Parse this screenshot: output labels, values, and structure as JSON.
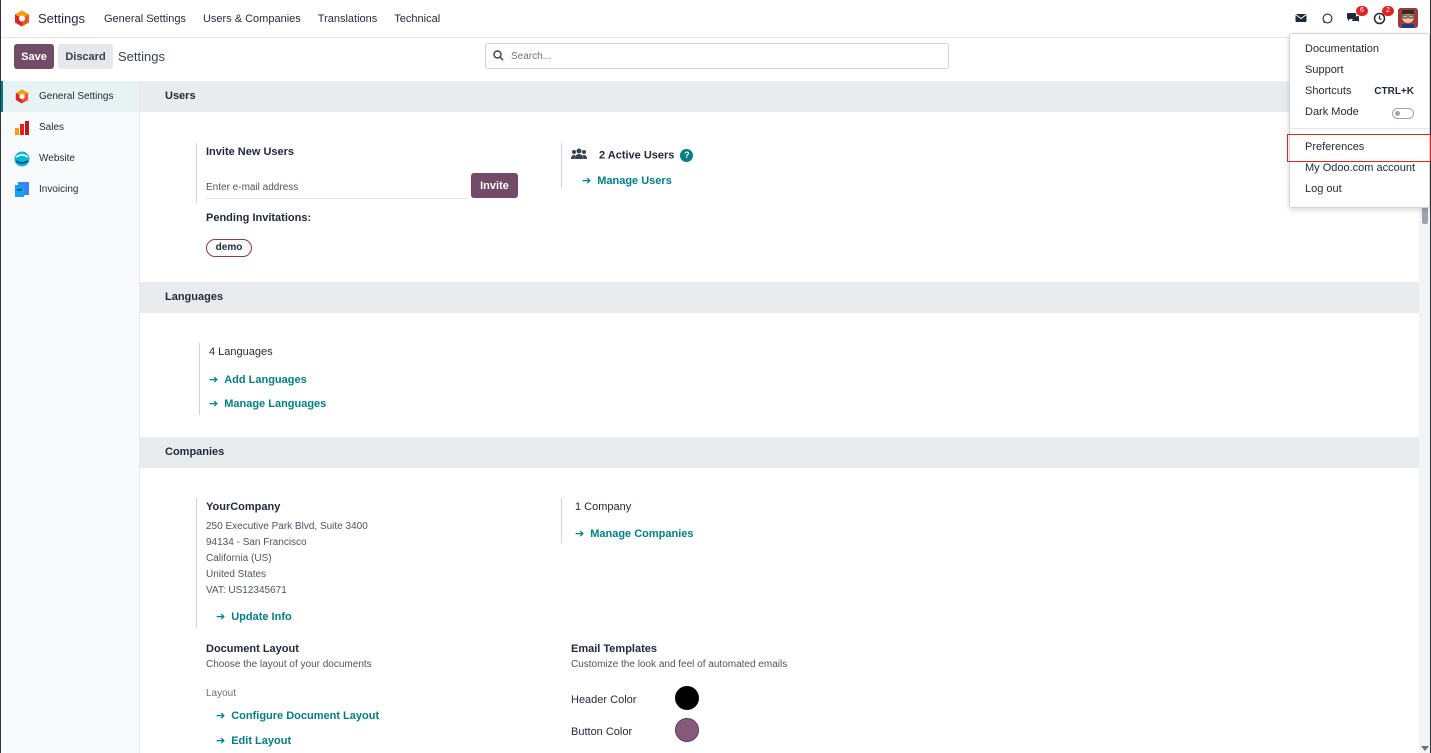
{
  "navbar": {
    "app_name": "Settings",
    "menu": [
      "General Settings",
      "Users & Companies",
      "Translations",
      "Technical"
    ],
    "chat_badge": "6",
    "activity_badge": "2"
  },
  "control_panel": {
    "save_label": "Save",
    "discard_label": "Discard",
    "title": "Settings",
    "search_placeholder": "Search..."
  },
  "sidebar": {
    "items": [
      {
        "label": "General Settings",
        "icon": "odoo-logo-icon"
      },
      {
        "label": "Sales",
        "icon": "sales-chart-icon"
      },
      {
        "label": "Website",
        "icon": "website-icon"
      },
      {
        "label": "Invoicing",
        "icon": "invoicing-icon"
      }
    ]
  },
  "users": {
    "section_title": "Users",
    "invite_title": "Invite New Users",
    "email_placeholder": "Enter e-mail address",
    "invite_label": "Invite",
    "pending_title": "Pending Invitations:",
    "pending_tag": "demo",
    "active_users": "2 Active Users",
    "manage_users": "Manage Users"
  },
  "languages": {
    "section_title": "Languages",
    "count": "4 Languages",
    "add": "Add Languages",
    "manage": "Manage Languages"
  },
  "companies": {
    "section_title": "Companies",
    "company_name": "YourCompany",
    "address_lines": [
      "250 Executive Park Blvd, Suite 3400",
      "94134 - San Francisco",
      "California (US)",
      "United States",
      "VAT:  US12345671"
    ],
    "update_info": "Update Info",
    "count": "1 Company",
    "manage": "Manage Companies",
    "doc_layout_title": "Document Layout",
    "doc_layout_desc": "Choose the layout of your documents",
    "layout_label": "Layout",
    "configure_layout": "Configure Document Layout",
    "edit_layout": "Edit Layout",
    "email_templates_title": "Email Templates",
    "email_templates_desc": "Customize the look and feel of automated emails",
    "header_color_label": "Header Color",
    "button_color_label": "Button Color",
    "header_color": "#000000",
    "button_color": "#875a7b"
  },
  "user_menu": {
    "documentation": "Documentation",
    "support": "Support",
    "shortcuts": "Shortcuts",
    "shortcuts_key": "CTRL+K",
    "dark_mode": "Dark Mode",
    "preferences": "Preferences",
    "account": "My Odoo.com account",
    "logout": "Log out"
  },
  "colors": {
    "primary": "#714b67",
    "link": "#017e84",
    "section_bg": "#e9ecef"
  }
}
